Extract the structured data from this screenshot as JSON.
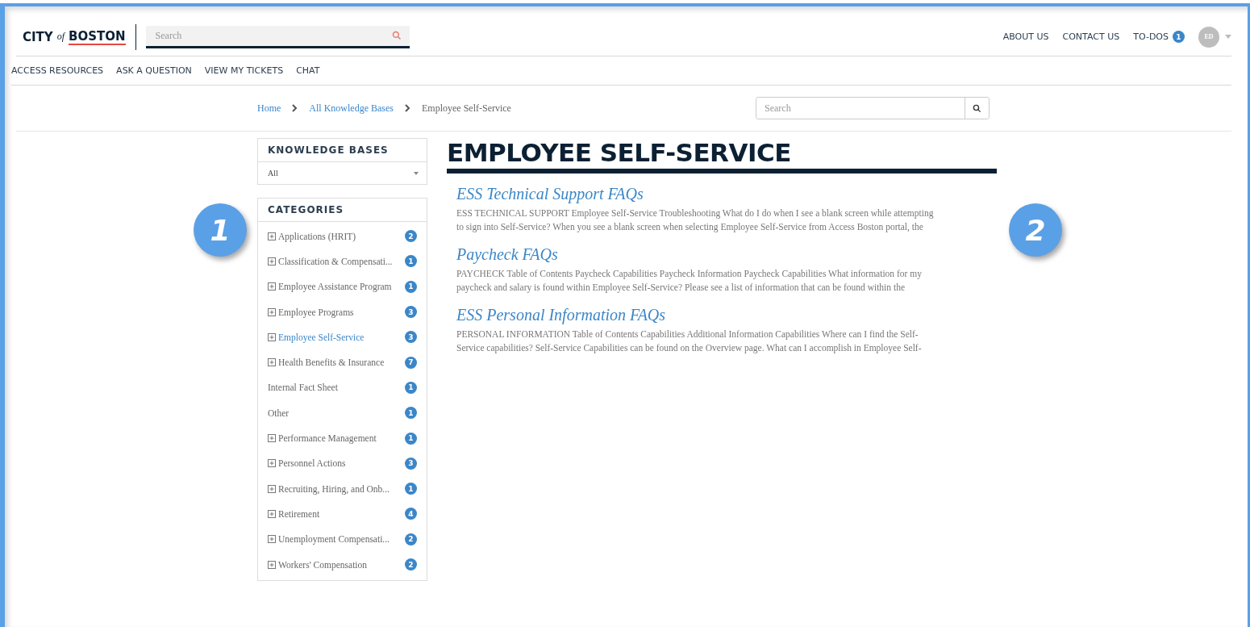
{
  "header": {
    "logo": {
      "city": "CITY",
      "of": "of",
      "boston": "BOSTON"
    },
    "search": {
      "placeholder": "Search"
    },
    "links": [
      "ABOUT US",
      "CONTACT US",
      "TO-DOS"
    ],
    "todo_count": "1",
    "avatar": "ED"
  },
  "nav": [
    "ACCESS RESOURCES",
    "ASK A QUESTION",
    "VIEW MY TICKETS",
    "CHAT"
  ],
  "breadcrumb": [
    {
      "label": "Home",
      "link": true
    },
    {
      "label": "All Knowledge Bases",
      "link": true
    },
    {
      "label": "Employee Self-Service",
      "link": false
    }
  ],
  "kb_search": {
    "placeholder": "Search"
  },
  "knowledge_bases": {
    "title": "KNOWLEDGE BASES",
    "value": "All"
  },
  "categories": {
    "title": "CATEGORIES",
    "items": [
      {
        "label": "Applications (HRIT)",
        "count": "2",
        "expandable": true,
        "selected": false
      },
      {
        "label": "Classification & Compensati...",
        "count": "1",
        "expandable": true,
        "selected": false
      },
      {
        "label": "Employee Assistance Program",
        "count": "1",
        "expandable": true,
        "selected": false
      },
      {
        "label": "Employee Programs",
        "count": "3",
        "expandable": true,
        "selected": false
      },
      {
        "label": "Employee Self-Service",
        "count": "3",
        "expandable": true,
        "selected": true
      },
      {
        "label": "Health Benefits & Insurance",
        "count": "7",
        "expandable": true,
        "selected": false
      },
      {
        "label": "Internal Fact Sheet",
        "count": "1",
        "expandable": false,
        "selected": false
      },
      {
        "label": "Other",
        "count": "1",
        "expandable": false,
        "selected": false
      },
      {
        "label": "Performance Management",
        "count": "1",
        "expandable": true,
        "selected": false
      },
      {
        "label": "Personnel Actions",
        "count": "3",
        "expandable": true,
        "selected": false
      },
      {
        "label": "Recruiting, Hiring, and Onb...",
        "count": "1",
        "expandable": true,
        "selected": false
      },
      {
        "label": "Retirement",
        "count": "4",
        "expandable": true,
        "selected": false
      },
      {
        "label": "Unemployment Compensati...",
        "count": "2",
        "expandable": true,
        "selected": false
      },
      {
        "label": "Workers' Compensation",
        "count": "2",
        "expandable": true,
        "selected": false
      }
    ]
  },
  "page_title": "EMPLOYEE SELF-SERVICE",
  "articles": [
    {
      "title": "ESS Technical Support FAQs",
      "lines": [
        "ESS TECHNICAL SUPPORT Employee Self-Service Troubleshooting What do I do when I see a blank screen while attempting",
        "to sign into Self-Service? When you see a blank screen when selecting Employee Self-Service from Access Boston portal, the"
      ]
    },
    {
      "title": "Paycheck FAQs",
      "lines": [
        "PAYCHECK Table of Contents Paycheck Capabilities Paycheck Information Paycheck Capabilities What information for my",
        "paycheck and salary is found within Employee Self-Service? Please see a list of information that can be found within the"
      ]
    },
    {
      "title": "ESS Personal Information FAQs",
      "lines": [
        "PERSONAL INFORMATION Table of Contents Capabilities Additional Information Capabilities Where can I find the Self-",
        "Service capabilities? Self-Service Capabilities can be found on the Overview page. What can I accomplish in Employee Self-"
      ]
    }
  ],
  "callouts": [
    "1",
    "2"
  ]
}
